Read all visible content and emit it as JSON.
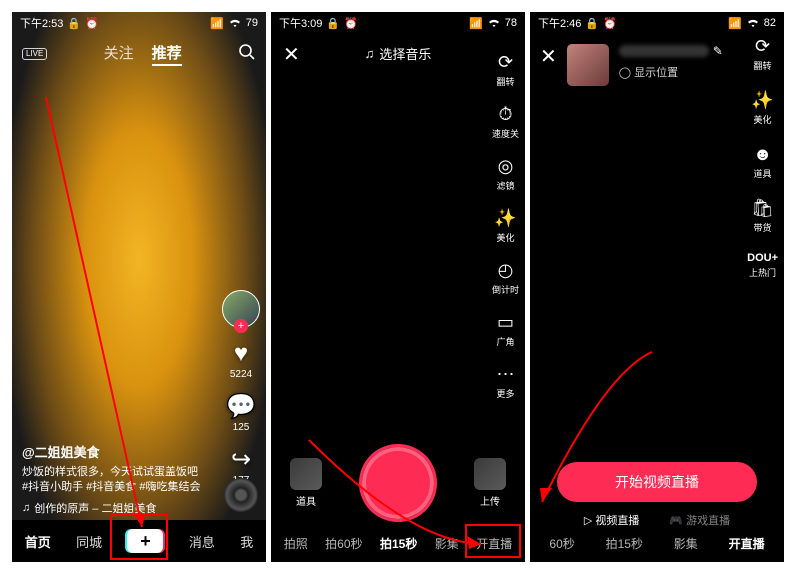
{
  "screen1": {
    "status": {
      "time": "下午2:53",
      "battery": "79"
    },
    "nav": {
      "follow": "关注",
      "recommend": "推荐",
      "live_badge": "LIVE"
    },
    "feed": {
      "user": "@二姐姐美食",
      "caption": "炒饭的样式很多，今天试试蛋盖饭吧 #抖音小助手 #抖音美食 #嗨吃集结会",
      "music": "创作的原声 – 二姐姐美食",
      "likes": "5224",
      "comments": "125",
      "shares": "177"
    },
    "bottom": {
      "home": "首页",
      "nearby": "同城",
      "inbox": "消息",
      "me": "我"
    }
  },
  "screen2": {
    "status": {
      "time": "下午3:09",
      "battery": "78"
    },
    "music_label": "选择音乐",
    "tools": {
      "flip": "翻转",
      "speed": "速度关",
      "filter": "滤镜",
      "beauty": "美化",
      "countdown": "倒计时",
      "wide": "广角",
      "more": "更多"
    },
    "bottom": {
      "effects": "道具",
      "upload": "上传"
    },
    "modes": {
      "photo": "拍照",
      "sixty": "拍60秒",
      "fifteen": "拍15秒",
      "album": "影集",
      "live": "开直播"
    }
  },
  "screen3": {
    "status": {
      "time": "下午2:46",
      "battery": "82"
    },
    "location": "显示位置",
    "tools": {
      "flip": "翻转",
      "beauty": "美化",
      "effects": "道具",
      "goods": "带货",
      "dou": "DOU+",
      "hot": "上热门"
    },
    "start_button": "开始视频直播",
    "live_types": {
      "video": "视频直播",
      "game": "游戏直播"
    },
    "modes": {
      "sixty": "60秒",
      "fifteen": "拍15秒",
      "album": "影集",
      "live": "开直播"
    }
  }
}
